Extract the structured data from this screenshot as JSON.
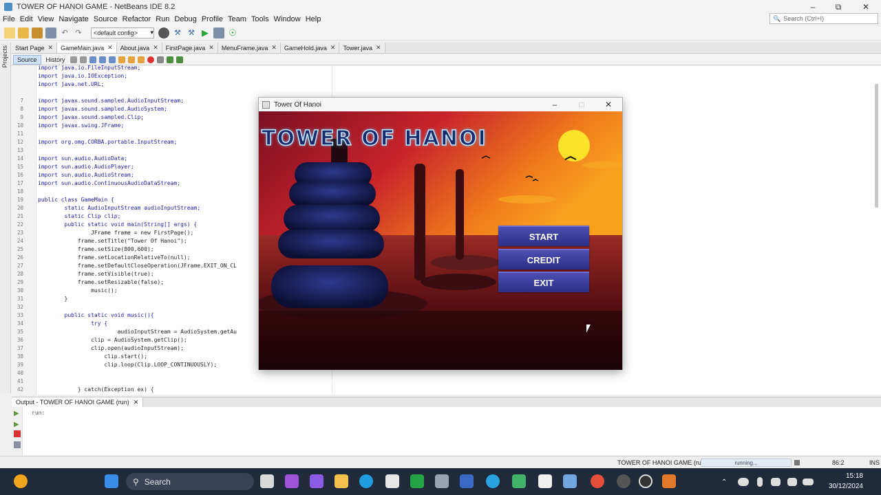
{
  "window": {
    "title": "TOWER OF HANOI GAME - NetBeans IDE 8.2"
  },
  "menubar": [
    "File",
    "Edit",
    "View",
    "Navigate",
    "Source",
    "Refactor",
    "Run",
    "Debug",
    "Profile",
    "Team",
    "Tools",
    "Window",
    "Help"
  ],
  "search": {
    "placeholder": "Search (Ctrl+I)"
  },
  "toolbar": {
    "config": "<default config>"
  },
  "side": {
    "projects_label": "Projects"
  },
  "editor_tabs": [
    {
      "label": "Start Page",
      "active": false
    },
    {
      "label": "GameMain.java",
      "active": true
    },
    {
      "label": "About.java",
      "active": false
    },
    {
      "label": "FirstPage.java",
      "active": false
    },
    {
      "label": "MenuFrame.java",
      "active": false
    },
    {
      "label": "GameHold.java",
      "active": false
    },
    {
      "label": "Tower.java",
      "active": false
    }
  ],
  "source_toolbar": {
    "source": "Source",
    "history": "History"
  },
  "code_lines": [
    {
      "n": "",
      "t": "import java.io.FileInputStream;"
    },
    {
      "n": "",
      "t": "import java.io.IOException;"
    },
    {
      "n": "",
      "t": "import java.net.URL;"
    },
    {
      "n": "",
      "t": ""
    },
    {
      "n": "7",
      "t": "import javax.sound.sampled.AudioInputStream;"
    },
    {
      "n": "8",
      "t": "import javax.sound.sampled.AudioSystem;"
    },
    {
      "n": "9",
      "t": "import javax.sound.sampled.Clip;"
    },
    {
      "n": "10",
      "t": "import javax.swing.JFrame;"
    },
    {
      "n": "11",
      "t": ""
    },
    {
      "n": "12",
      "t": "import org.omg.CORBA.portable.InputStream;"
    },
    {
      "n": "13",
      "t": ""
    },
    {
      "n": "14",
      "t": "import sun.audio.AudioData;"
    },
    {
      "n": "15",
      "t": "import sun.audio.AudioPlayer;"
    },
    {
      "n": "16",
      "t": "import sun.audio.AudioStream;"
    },
    {
      "n": "17",
      "t": "import sun.audio.ContinuousAudioDataStream;"
    },
    {
      "n": "18",
      "t": ""
    },
    {
      "n": "19",
      "t": "public class GameMain {"
    },
    {
      "n": "20",
      "t": "        static AudioInputStream audioInputStream;"
    },
    {
      "n": "21",
      "t": "        static Clip clip;"
    },
    {
      "n": "22",
      "t": "        public static void main(String[] args) {"
    },
    {
      "n": "23",
      "t": "                JFrame frame = new FirstPage();"
    },
    {
      "n": "24",
      "t": "            frame.setTitle(\"Tower Of Hanoi\");"
    },
    {
      "n": "25",
      "t": "            frame.setSize(800,600);"
    },
    {
      "n": "26",
      "t": "            frame.setLocationRelativeTo(null);"
    },
    {
      "n": "27",
      "t": "            frame.setDefaultCloseOperation(JFrame.EXIT_ON_CL"
    },
    {
      "n": "28",
      "t": "            frame.setVisible(true);"
    },
    {
      "n": "29",
      "t": "            frame.setResizable(false);"
    },
    {
      "n": "30",
      "t": "                music();"
    },
    {
      "n": "31",
      "t": "        }"
    },
    {
      "n": "32",
      "t": ""
    },
    {
      "n": "33",
      "t": "        public static void music(){"
    },
    {
      "n": "34",
      "t": "                try {"
    },
    {
      "n": "35",
      "t": "                        audioInputStream = AudioSystem.getAu"
    },
    {
      "n": "36",
      "t": "                clip = AudioSystem.getClip();"
    },
    {
      "n": "37",
      "t": "                clip.open(audioInputStream);"
    },
    {
      "n": "38",
      "t": "                    clip.start();"
    },
    {
      "n": "39",
      "t": "                    clip.loop(Clip.LOOP_CONTINUOUSLY);"
    },
    {
      "n": "40",
      "t": ""
    },
    {
      "n": "41",
      "t": ""
    },
    {
      "n": "42",
      "t": "            } catch(Exception ex) {"
    }
  ],
  "output": {
    "tab_label": "Output - TOWER OF HANOI GAME (run)",
    "text": "run:"
  },
  "statusbar": {
    "task": "TOWER OF HANOI GAME (run)",
    "progress": "running...",
    "position": "86:2",
    "mode": "INS"
  },
  "game": {
    "title": "Tower Of Hanoi",
    "logo": "TOWER OF HANOI",
    "buttons": [
      "START",
      "CREDIT",
      "EXIT"
    ]
  },
  "taskbar": {
    "search": "Search",
    "time": "15:18",
    "date": "30/12/2024"
  },
  "colors": {
    "sunset_top": "#c8232a",
    "sunset_mid": "#f07b1c",
    "button": "#3a3d9a",
    "taskbar": "#202a3a"
  }
}
